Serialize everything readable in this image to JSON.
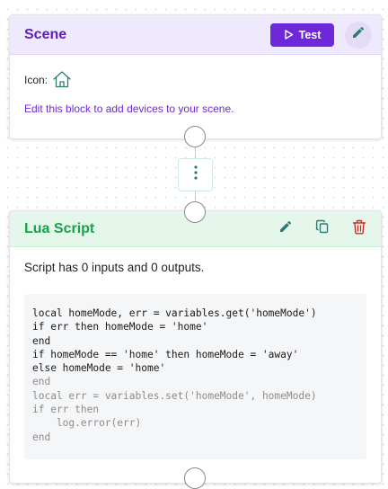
{
  "scene": {
    "title": "Scene",
    "test_label": "Test",
    "icon_label": "Icon:",
    "edit_hint": "Edit this block to add devices to your scene."
  },
  "lua": {
    "title": "Lua Script",
    "io_summary": "Script has 0 inputs and 0 outputs.",
    "code_lines": [
      {
        "text": "local homeMode, err = variables.get('homeMode')",
        "style": "active"
      },
      {
        "text": "if err then homeMode = 'home'",
        "style": "active"
      },
      {
        "text": "end",
        "style": "active"
      },
      {
        "text": "if homeMode == 'home' then homeMode = 'away'",
        "style": "active"
      },
      {
        "text": "else homeMode = 'home'",
        "style": "active"
      },
      {
        "text": "end",
        "style": "dim"
      },
      {
        "text": "local err = variables.set('homeMode', homeMode)",
        "style": "dim"
      },
      {
        "text": "if err then",
        "style": "dim"
      },
      {
        "text": "    log.error(err)",
        "style": "dim"
      },
      {
        "text": "end",
        "style": "dim"
      }
    ]
  },
  "icons": {
    "play": "play-icon",
    "scene_edit": "pencil-icon",
    "scene_icon": "home-icon",
    "menu": "vertical-dots-icon",
    "lua_edit": "pencil-icon",
    "lua_copy": "copy-icon",
    "lua_delete": "trash-icon"
  },
  "colors": {
    "scene_accent": "#6d28d9",
    "scene_header_bg": "#efe9fd",
    "lua_accent": "#16a34a",
    "lua_header_bg": "#e4f7ea",
    "delete_red": "#dc2626",
    "home_icon": "#2f7a6f"
  }
}
